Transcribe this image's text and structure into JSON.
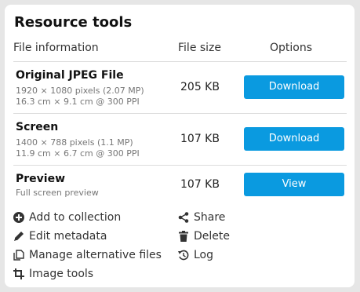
{
  "panel": {
    "title": "Resource tools",
    "headers": {
      "file_info": "File information",
      "file_size": "File size",
      "options": "Options"
    },
    "rows": [
      {
        "name": "Original JPEG File",
        "line1": "1920 × 1080 pixels (2.07 MP)",
        "line2": "16.3 cm × 9.1 cm @ 300 PPI",
        "size": "205 KB",
        "button": "Download"
      },
      {
        "name": "Screen",
        "line1": "1400 × 788 pixels (1.1 MP)",
        "line2": "11.9 cm × 6.7 cm @ 300 PPI",
        "size": "107 KB",
        "button": "Download"
      },
      {
        "name": "Preview",
        "line1": "Full screen preview",
        "size": "107 KB",
        "button": "View"
      }
    ],
    "actions": {
      "add_to_collection": "Add to collection",
      "edit_metadata": "Edit metadata",
      "manage_alternative_files": "Manage alternative files",
      "image_tools": "Image tools",
      "share": "Share",
      "delete": "Delete",
      "log": "Log"
    },
    "colors": {
      "button": "#0a9ae0",
      "background": "#e6e6e6",
      "panel": "#ffffff"
    }
  }
}
